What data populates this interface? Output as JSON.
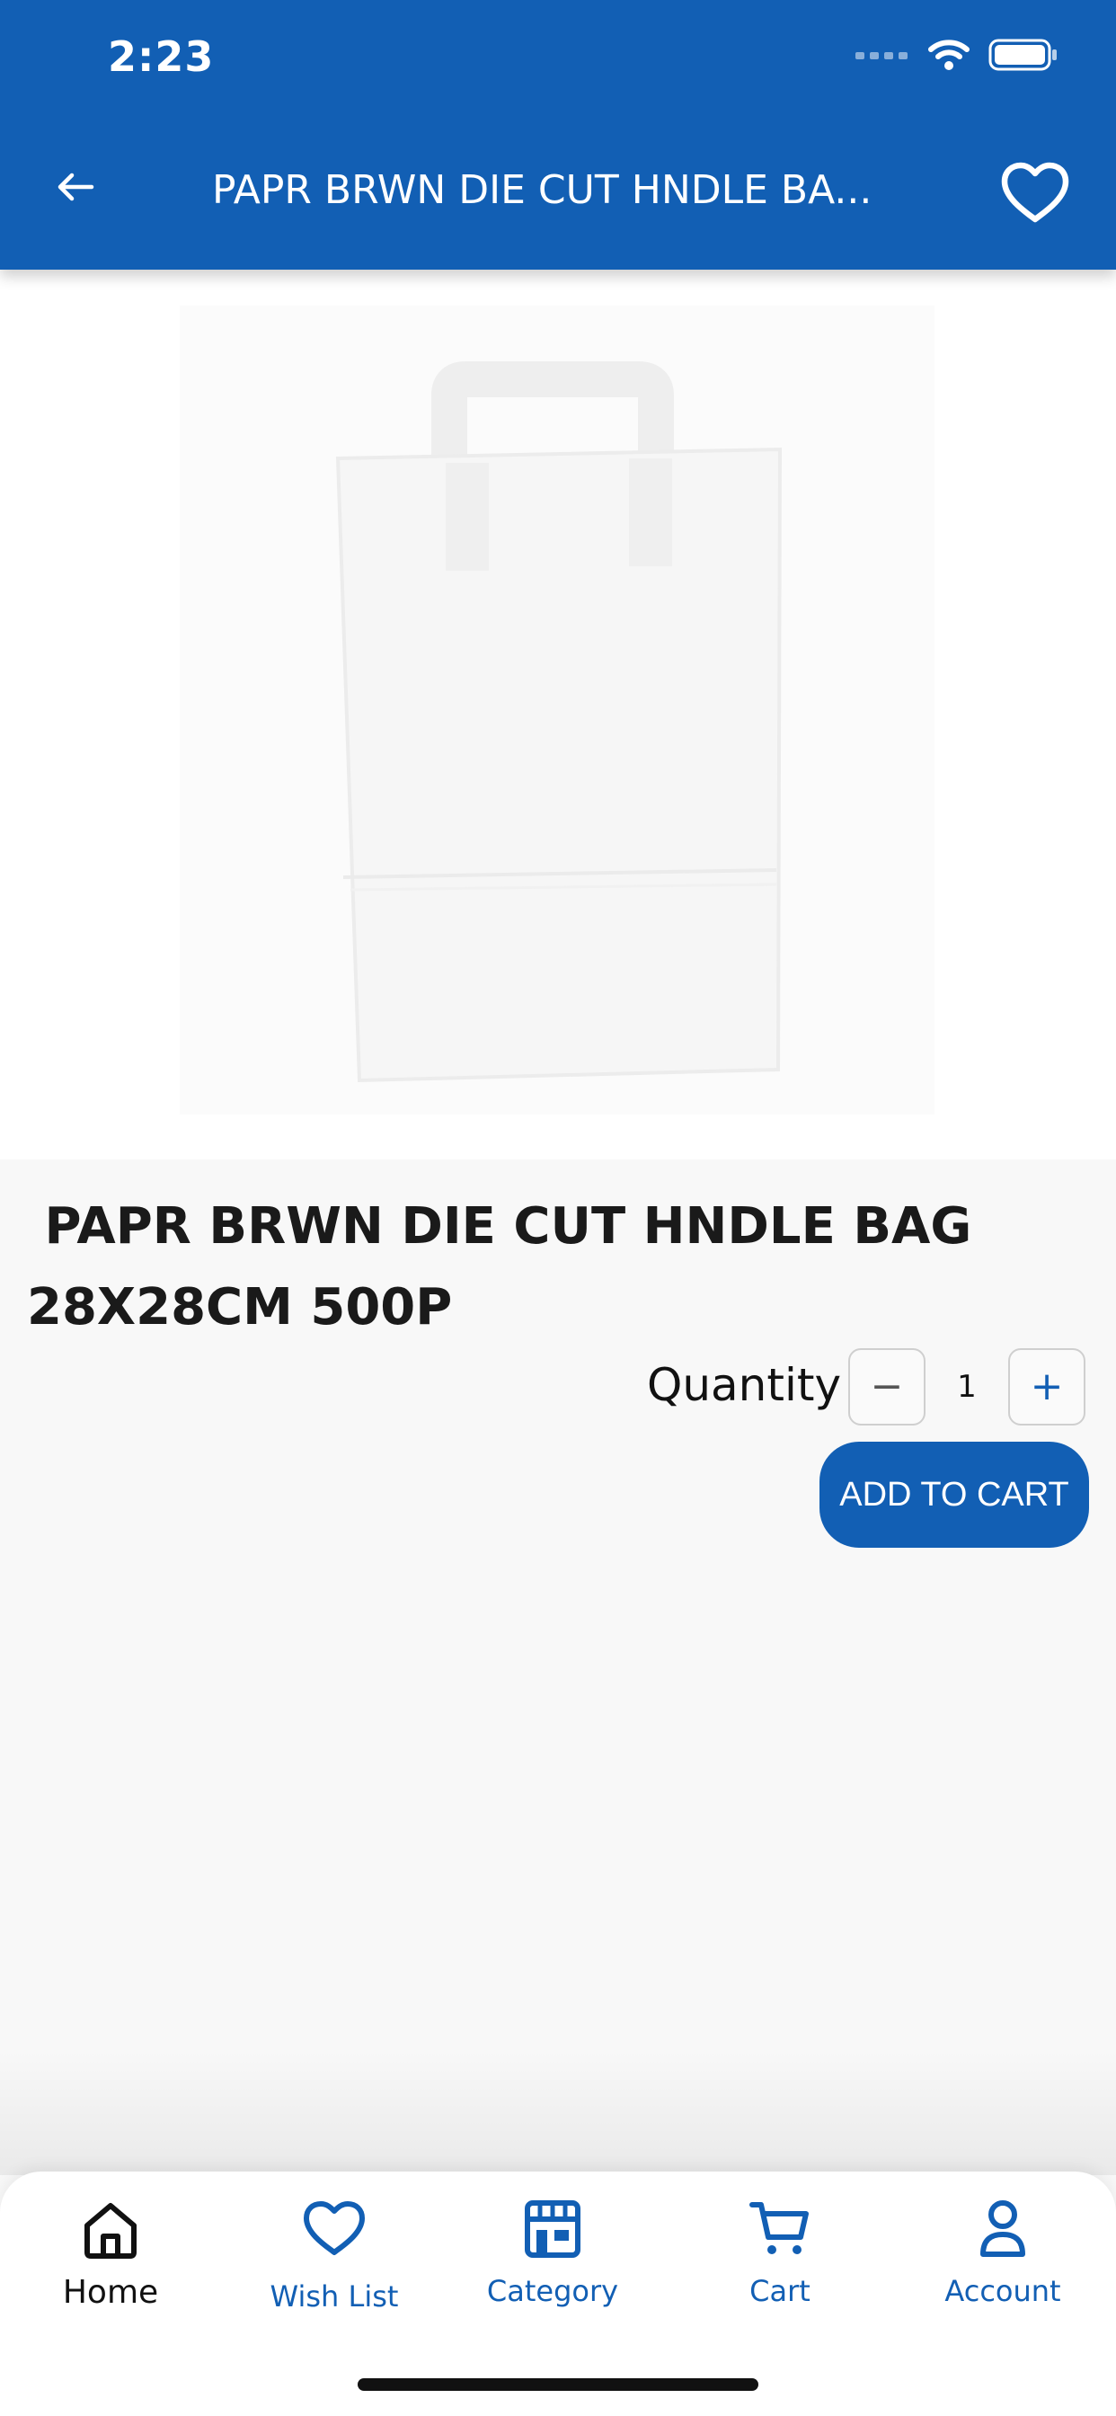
{
  "status_bar": {
    "time": "2:23"
  },
  "header": {
    "title": "PAPR BRWN DIE CUT HNDLE BA...",
    "background_color": "#125fb4",
    "back_icon": "arrow-left-icon",
    "wishlist_icon": "heart-outline-icon"
  },
  "product": {
    "image_description_icon": "paper-bag-image",
    "title": " PAPR BRWN DIE CUT HNDLE BAG 28X28CM 500P",
    "quantity_label": "Quantity",
    "quantity_value": "1",
    "decrease_symbol": "−",
    "increase_symbol": "+",
    "add_to_cart_label": "ADD TO CART"
  },
  "bottom_nav": {
    "items": [
      {
        "label": "Home",
        "icon": "home-icon",
        "active": true
      },
      {
        "label": "Wish List",
        "icon": "heart-icon",
        "active": false
      },
      {
        "label": "Category",
        "icon": "store-icon",
        "active": false
      },
      {
        "label": "Cart",
        "icon": "cart-icon",
        "active": false
      },
      {
        "label": "Account",
        "icon": "user-icon",
        "active": false
      }
    ]
  },
  "colors": {
    "brand": "#125fb4",
    "page_background": "#f8f8f8"
  }
}
